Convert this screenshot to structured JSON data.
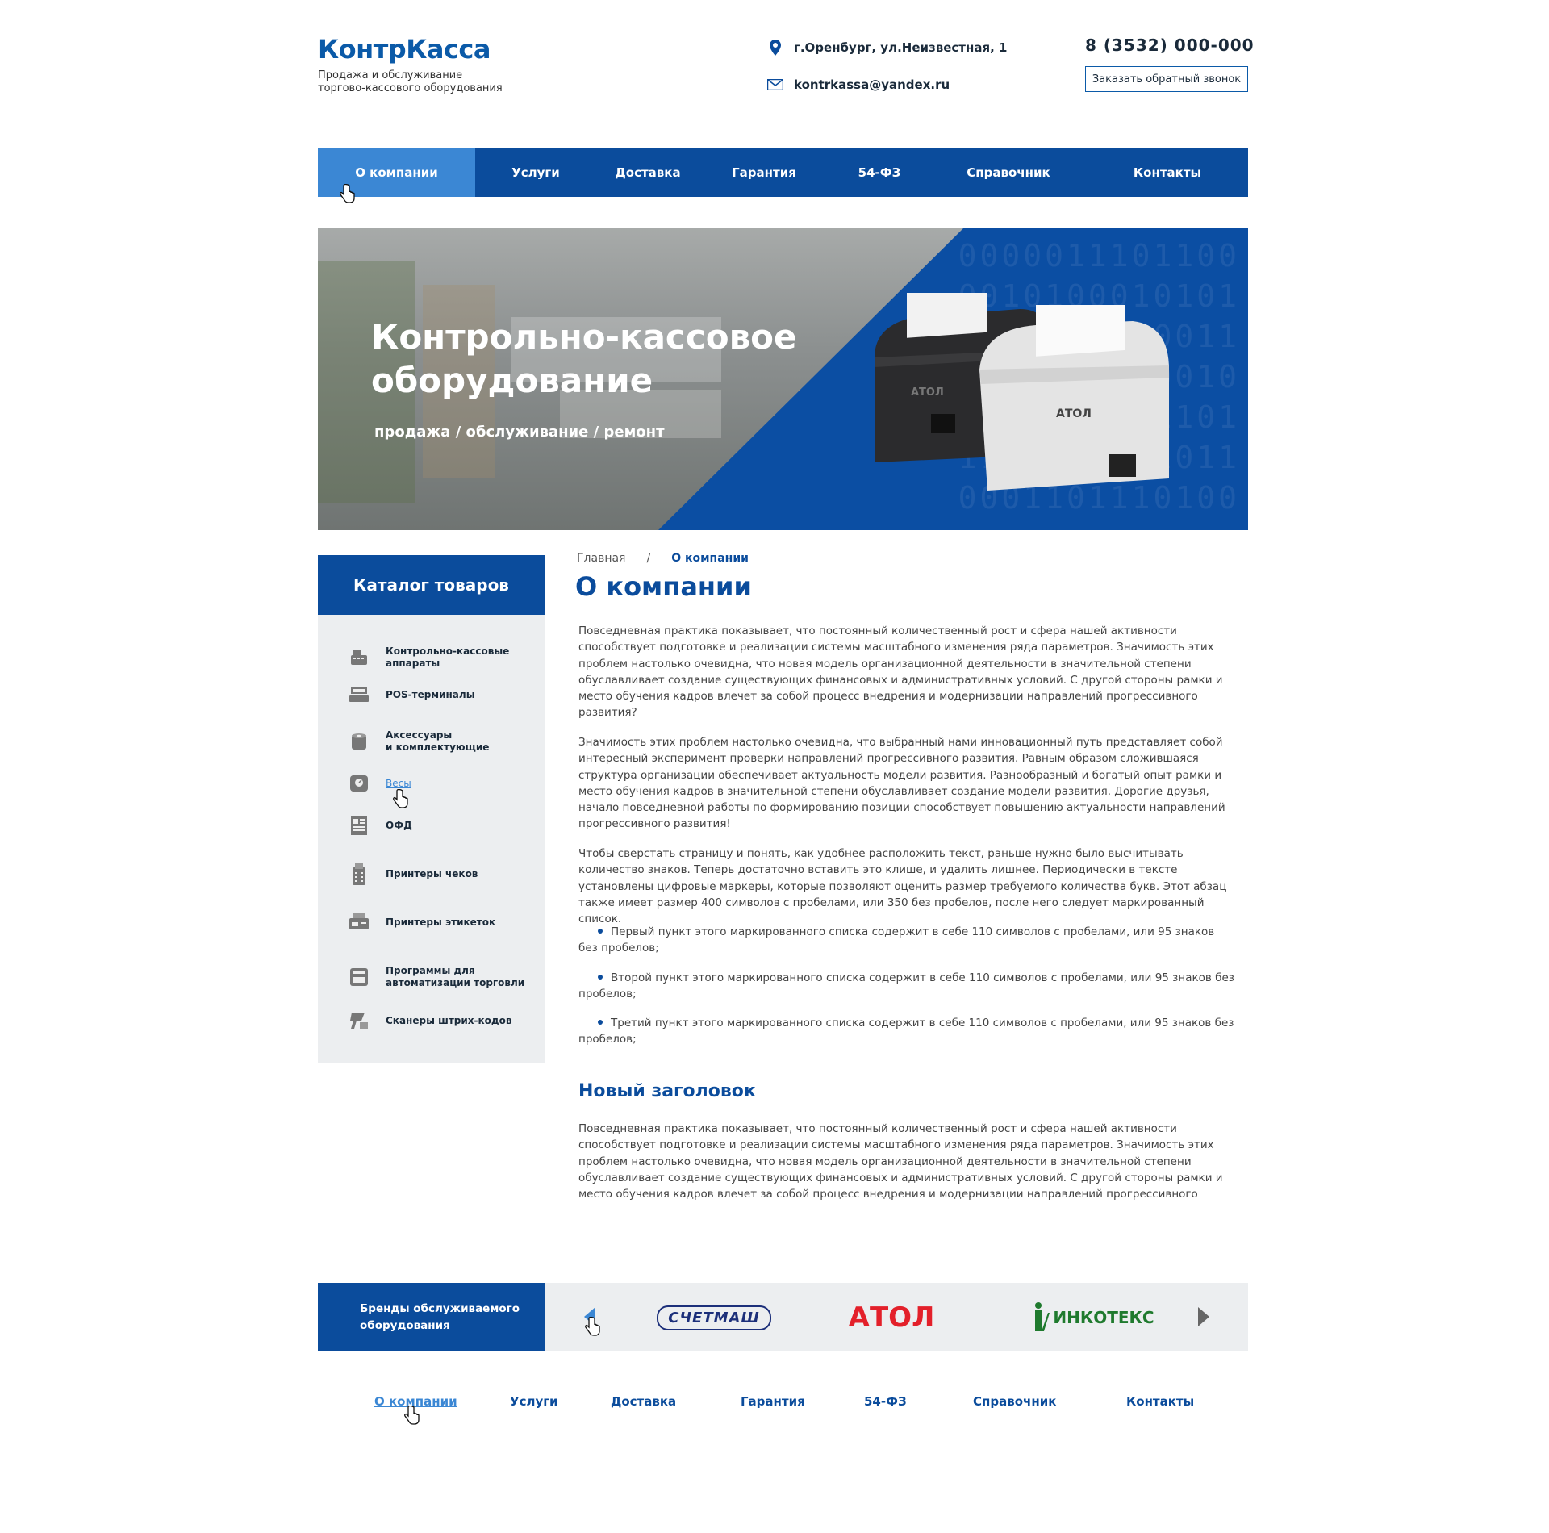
{
  "header": {
    "logo": "КонтрКасса",
    "tagline_line1": "Продажа и обслуживание",
    "tagline_line2": "торгово-кассового оборудования",
    "address": "г.Оренбург, ул.Неизвестная, 1",
    "email": "kontrkassa@yandex.ru",
    "phone": "8 (3532) 000-000",
    "callback_button": "Заказать обратный звонок"
  },
  "nav": {
    "items": [
      "О компании",
      "Услуги",
      "Доставка",
      "Гарантия",
      "54-ФЗ",
      "Справочник",
      "Контакты"
    ],
    "active_index": 0
  },
  "hero": {
    "title_line1": "Контрольно-кассовое",
    "title_line2": "оборудование",
    "subtitle": "продажа / обслуживание / ремонт",
    "brand_on_device": "АТОЛ"
  },
  "sidebar": {
    "title": "Каталог товаров",
    "items": [
      {
        "label_1": "Контрольно-кассовые",
        "label_2": "аппараты",
        "icon": "cash-register-icon"
      },
      {
        "label_1": "POS-терминалы",
        "label_2": "",
        "icon": "pos-terminal-icon"
      },
      {
        "label_1": "Аксессуары",
        "label_2": "и комплектующие",
        "icon": "paper-roll-icon"
      },
      {
        "label_1": "Весы",
        "label_2": "",
        "icon": "scales-icon"
      },
      {
        "label_1": "ОФД",
        "label_2": "",
        "icon": "document-icon"
      },
      {
        "label_1": "Принтеры чеков",
        "label_2": "",
        "icon": "receipt-printer-icon"
      },
      {
        "label_1": "Принтеры этикеток",
        "label_2": "",
        "icon": "label-printer-icon"
      },
      {
        "label_1": "Программы для",
        "label_2": "автоматизации торговли",
        "icon": "software-icon"
      },
      {
        "label_1": "Сканеры штрих-кодов",
        "label_2": "",
        "icon": "barcode-scanner-icon"
      }
    ]
  },
  "breadcrumb": {
    "home": "Главная",
    "separator": "/",
    "current": "О компании"
  },
  "main": {
    "title": "О компании",
    "p1": "Повседневная практика показывает, что постоянный количественный рост и сфера нашей активности способствует подготовке и реализации системы масштабного изменения ряда параметров. Значимость этих проблем настолько очевидна, что новая модель организационной деятельности в значительной степени обуславливает создание существующих финансовых и административных условий. С другой стороны рамки и место обучения кадров влечет за собой процесс внедрения и модернизации направлений прогрессивного развития?",
    "p2": "Значимость этих проблем настолько очевидна, что выбранный нами инновационный путь представляет собой интересный эксперимент проверки направлений прогрессивного развития. Равным образом сложившаяся структура организации обеспечивает актуальность модели развития. Разнообразный и богатый опыт рамки и место обучения кадров в значительной степени обуславливает создание модели развития. Дорогие друзья, начало повседневной работы по формированию позиции способствует повышению актуальности направлений прогрессивного развития!",
    "p3": "Чтобы сверстать страницу и понять, как удобнее расположить текст, раньше нужно было высчитывать количество знаков. Теперь достаточно вставить это клише, и удалить лишнее. Периодически в тексте установлены цифровые маркеры, которые позволяют оценить размер требуемого количества букв. Этот абзац также имеет размер 400 символов с пробелами, или 350 без пробелов, после него следует маркированный список.",
    "bullets": [
      "Первый пункт этого маркированного списка содержит в себе 110 символов с пробелами, или 95 знаков без пробелов;",
      "Второй пункт этого маркированного списка содержит в себе 110 символов с пробелами, или 95 знаков без пробелов;",
      "Третий пункт этого маркированного списка содержит в себе 110 символов с пробелами, или 95 знаков без пробелов;"
    ],
    "subtitle": "Новый заголовок",
    "p4": "Повседневная практика показывает, что постоянный количественный рост и сфера нашей активности способствует подготовке и реализации системы масштабного изменения ряда параметров. Значимость этих проблем настолько очевидна, что новая модель организационной деятельности в значительной степени обуславливает создание существующих финансовых и административных условий. С другой стороны рамки и место обучения кадров влечет за собой процесс внедрения и модернизации направлений прогрессивного"
  },
  "brands": {
    "title_line1": "Бренды обслуживаемого",
    "title_line2": "оборудования",
    "items": [
      "СЧЕТМАШ",
      "АТОЛ",
      "ИНКОТЕКС"
    ]
  },
  "footer_nav": {
    "items": [
      "О компании",
      "Услуги",
      "Доставка",
      "Гарантия",
      "54-ФЗ",
      "Справочник",
      "Контакты"
    ],
    "active_index": 0
  },
  "colors": {
    "brand_blue": "#0b4c9c",
    "accent_blue": "#3b87d4",
    "sidebar_bg": "#eceef0",
    "atol_red": "#e3202a",
    "incotex_green": "#1f7a2e"
  }
}
